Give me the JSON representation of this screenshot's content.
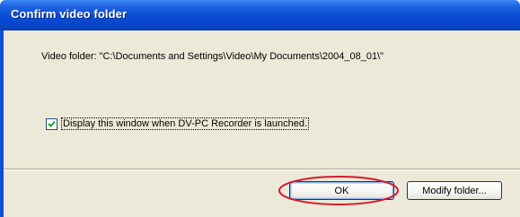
{
  "dialog": {
    "title": "Confirm video folder",
    "folder_text": "Video folder: \"C:\\Documents and Settings\\Video\\My Documents\\2004_08_01\\\"",
    "checkbox_label": "Display this window when DV-PC Recorder is launched.",
    "checkbox_checked": true
  },
  "buttons": {
    "ok_label": "OK",
    "modify_label": "Modify folder..."
  },
  "colors": {
    "titlebar": "#0a4cd6",
    "dialog_bg": "#ece9d8",
    "highlight": "#d61a2a"
  }
}
